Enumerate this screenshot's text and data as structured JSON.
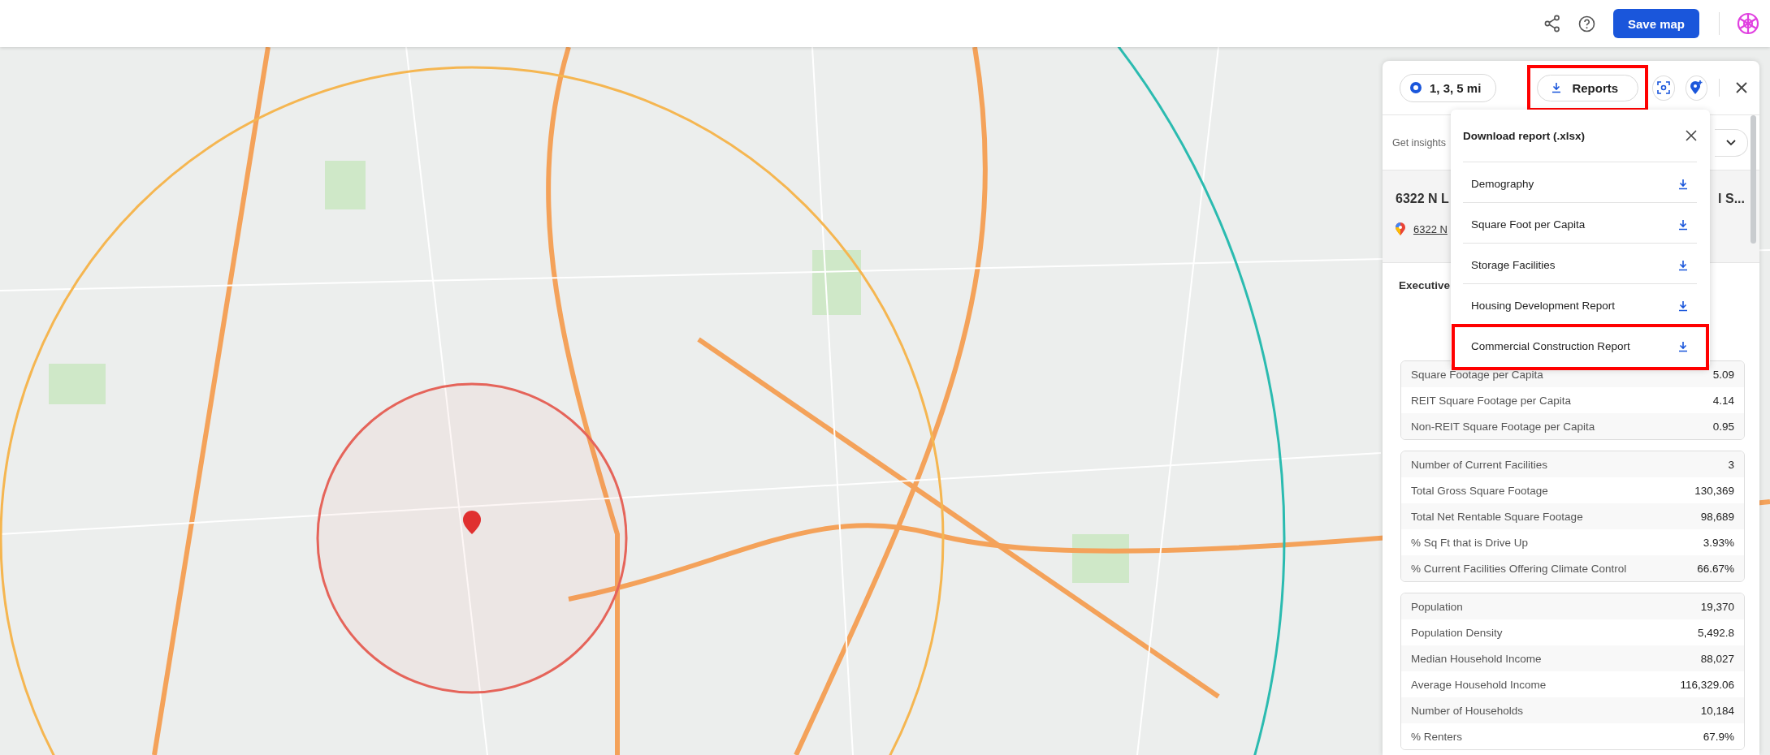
{
  "topbar": {
    "save_button": "Save map"
  },
  "panel": {
    "radius_chip": "1, 3, 5 mi",
    "reports_button": {
      "label": "Reports",
      "highlighted": true
    },
    "insights_label": "Get insights",
    "title_start": "6322 N L",
    "title_end": "l S...",
    "address_link": "6322 N",
    "section_title": "Executive",
    "stat_groups": [
      {
        "rows": [
          {
            "label": "Square Footage per Capita",
            "value": "5.09"
          },
          {
            "label": "REIT Square Footage per Capita",
            "value": "4.14"
          },
          {
            "label": "Non-REIT Square Footage per Capita",
            "value": "0.95"
          }
        ]
      },
      {
        "rows": [
          {
            "label": "Number of Current Facilities",
            "value": "3"
          },
          {
            "label": "Total Gross Square Footage",
            "value": "130,369"
          },
          {
            "label": "Total Net Rentable Square Footage",
            "value": "98,689"
          },
          {
            "label": "% Sq Ft that is Drive Up",
            "value": "3.93%"
          },
          {
            "label": "% Current Facilities Offering Climate Control",
            "value": "66.67%"
          }
        ]
      },
      {
        "rows": [
          {
            "label": "Population",
            "value": "19,370"
          },
          {
            "label": "Population Density",
            "value": "5,492.8"
          },
          {
            "label": "Median Household Income",
            "value": "88,027"
          },
          {
            "label": "Average Household Income",
            "value": "116,329.06"
          },
          {
            "label": "Number of Households",
            "value": "10,184"
          },
          {
            "label": "% Renters",
            "value": "67.9%"
          }
        ]
      }
    ]
  },
  "dropdown": {
    "title": "Download report (.xlsx)",
    "items": [
      {
        "label": "Demography",
        "highlighted": false
      },
      {
        "label": "Square Foot per Capita",
        "highlighted": false
      },
      {
        "label": "Storage Facilities",
        "highlighted": false
      },
      {
        "label": "Housing Development Report",
        "highlighted": false
      },
      {
        "label": "Commercial Construction Report",
        "highlighted": true
      }
    ]
  }
}
